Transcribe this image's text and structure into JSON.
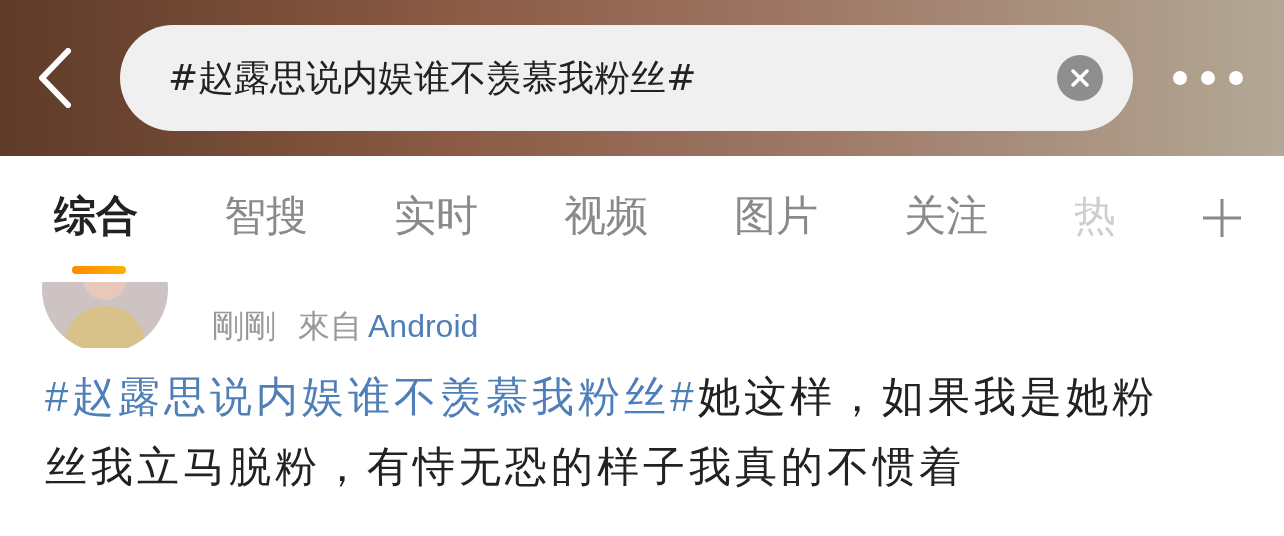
{
  "search": {
    "value": "#赵露思说内娱谁不羡慕我粉丝#"
  },
  "tabs": [
    {
      "label": "综合",
      "selected": true
    },
    {
      "label": "智搜",
      "selected": false
    },
    {
      "label": "实时",
      "selected": false
    },
    {
      "label": "视频",
      "selected": false
    },
    {
      "label": "图片",
      "selected": false
    },
    {
      "label": "关注",
      "selected": false
    },
    {
      "label": "热",
      "selected": false
    }
  ],
  "post": {
    "time": "剛剛",
    "source_prefix": "來自",
    "source": "Android",
    "hashtag": "#赵露思说内娱谁不羡慕我粉丝#",
    "text": "她这样，如果我是她粉丝我立马脱粉，有恃无恐的样子我真的不惯着"
  }
}
